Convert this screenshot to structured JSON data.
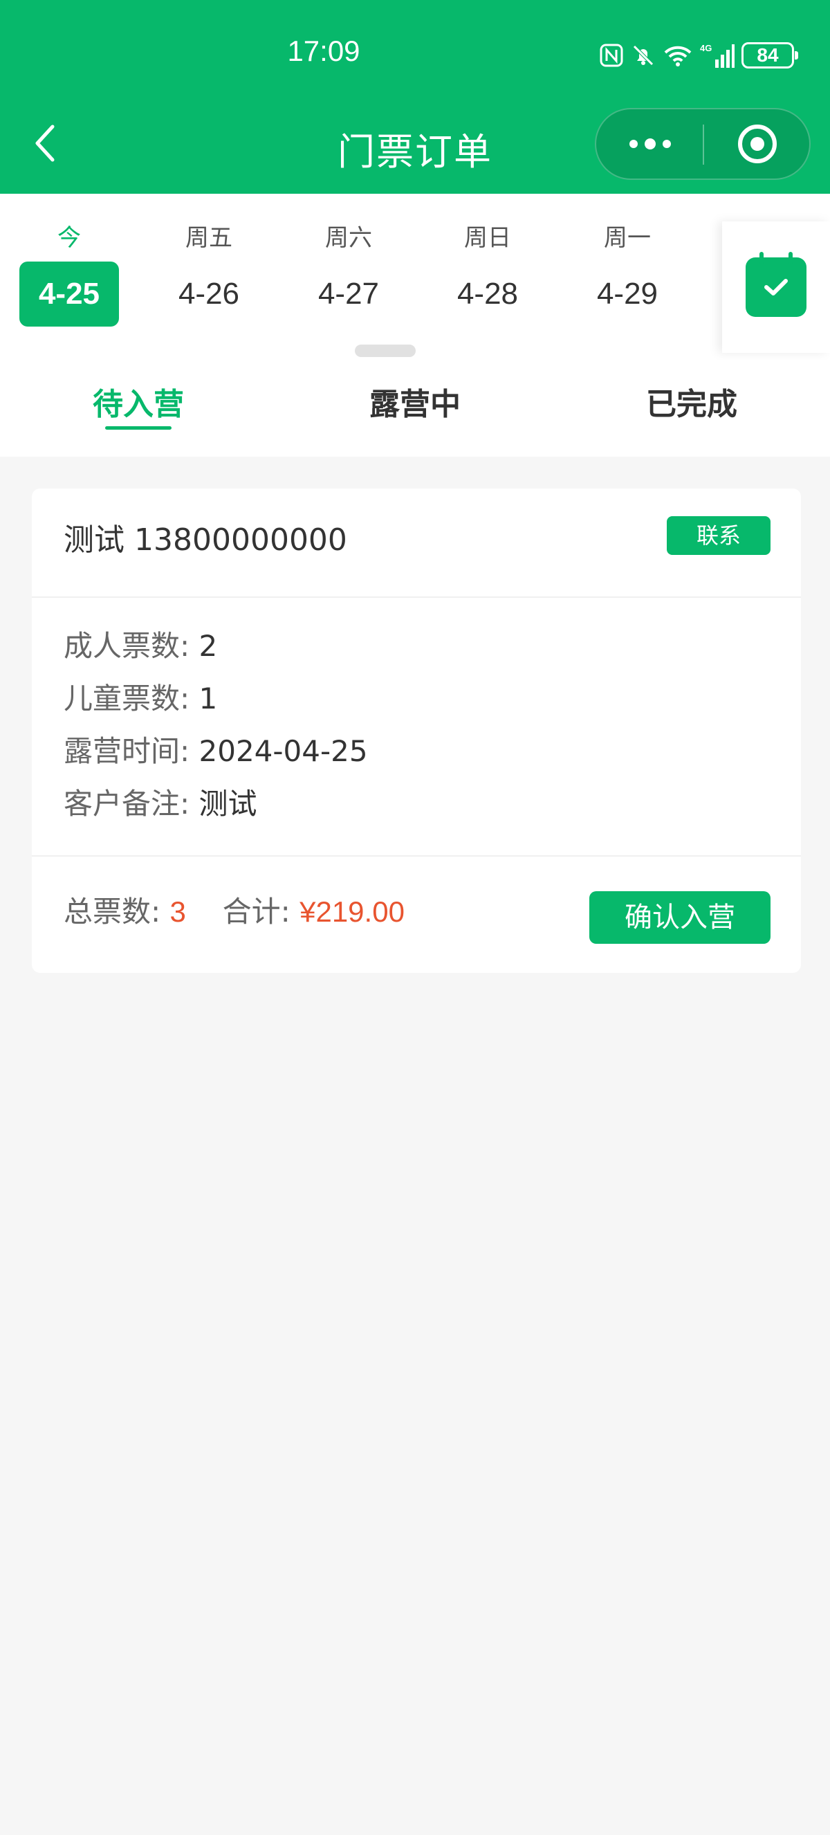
{
  "status_bar": {
    "time": "17:09",
    "battery": "84",
    "icons": [
      "nfc-icon",
      "bell-muted-icon",
      "wifi-icon",
      "signal-4g-icon",
      "battery-icon"
    ]
  },
  "nav": {
    "title": "门票订单",
    "back_icon": "chevron-left-icon",
    "more_icon": "more-dots-icon",
    "close_icon": "target-ring-icon"
  },
  "dates": [
    {
      "weekday": "今",
      "date": "4-25",
      "active": true
    },
    {
      "weekday": "周五",
      "date": "4-26",
      "active": false
    },
    {
      "weekday": "周六",
      "date": "4-27",
      "active": false
    },
    {
      "weekday": "周日",
      "date": "4-28",
      "active": false
    },
    {
      "weekday": "周一",
      "date": "4-29",
      "active": false
    }
  ],
  "calendar_icon": "calendar-check-icon",
  "tabs": [
    {
      "label": "待入营",
      "active": true
    },
    {
      "label": "露营中",
      "active": false
    },
    {
      "label": "已完成",
      "active": false
    }
  ],
  "order": {
    "customer": "测试 13800000000",
    "contact_label": "联系",
    "details": [
      {
        "label": "成人票数:",
        "value": "2"
      },
      {
        "label": "儿童票数:",
        "value": "1"
      },
      {
        "label": "露营时间:",
        "value": "2024-04-25"
      },
      {
        "label": "客户备注:",
        "value": "测试"
      }
    ],
    "total_tickets_label": "总票数:",
    "total_tickets": "3",
    "total_label": "合计:",
    "total_price": "¥219.00",
    "confirm_label": "确认入营"
  },
  "colors": {
    "brand": "#07b86b",
    "price": "#e8542f",
    "background": "#f6f6f6"
  }
}
